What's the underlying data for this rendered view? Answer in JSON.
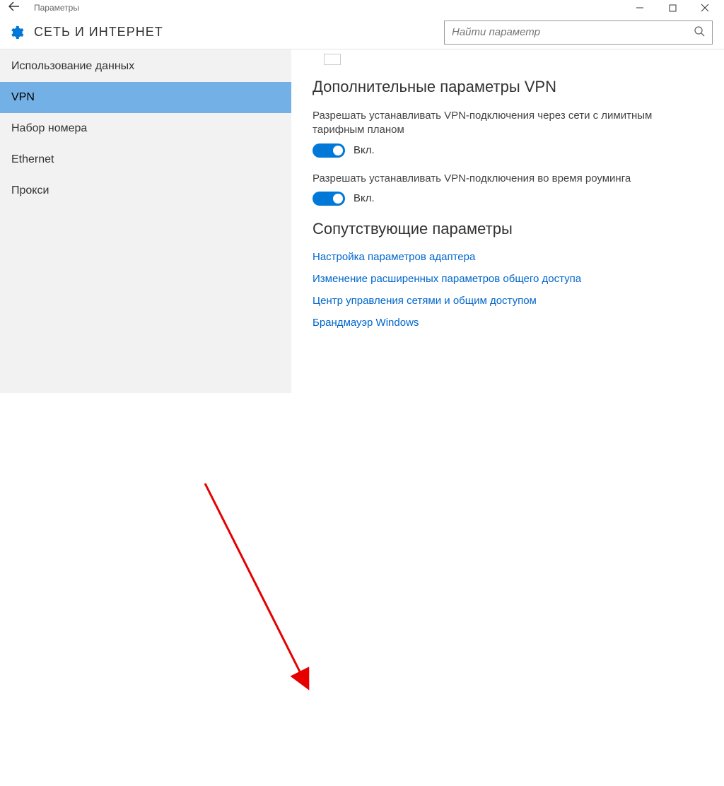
{
  "window": {
    "title": "Параметры",
    "search_placeholder": "Найти параметр"
  },
  "header": {
    "app_title": "СЕТЬ И ИНТЕРНЕТ"
  },
  "sidebar": {
    "items": [
      {
        "label": "Использование данных",
        "active": false
      },
      {
        "label": "VPN",
        "active": true
      },
      {
        "label": "Набор номера",
        "active": false
      },
      {
        "label": "Ethernet",
        "active": false
      },
      {
        "label": "Прокси",
        "active": false
      }
    ]
  },
  "main": {
    "section1_title": "Дополнительные параметры VPN",
    "opt1_label": "Разрешать устанавливать VPN-подключения через сети с лимитным тарифным планом",
    "opt1_state": "Вкл.",
    "opt2_label": "Разрешать устанавливать VPN-подключения во время роуминга",
    "opt2_state": "Вкл.",
    "section2_title": "Сопутствующие параметры",
    "links": [
      "Настройка параметров адаптера",
      "Изменение расширенных параметров общего доступа",
      "Центр управления сетями и общим доступом",
      "Брандмауэр Windows"
    ]
  }
}
